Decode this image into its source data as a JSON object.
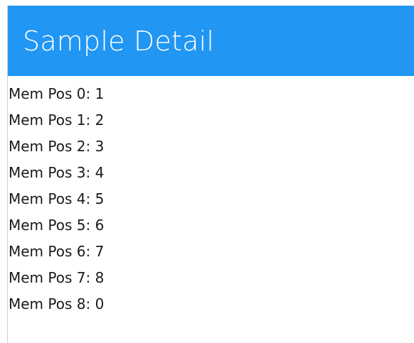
{
  "header": {
    "title": "Sample Detail"
  },
  "items": [
    {
      "label": "Mem Pos 0: 1"
    },
    {
      "label": "Mem Pos 1: 2"
    },
    {
      "label": "Mem Pos 2: 3"
    },
    {
      "label": "Mem Pos 3: 4"
    },
    {
      "label": "Mem Pos 4: 5"
    },
    {
      "label": "Mem Pos 5: 6"
    },
    {
      "label": "Mem Pos 6: 7"
    },
    {
      "label": "Mem Pos 7: 8"
    },
    {
      "label": "Mem Pos 8: 0"
    }
  ],
  "colors": {
    "header_background": "#2196f3",
    "header_text": "#ffffff",
    "body_text": "#1a1a1a"
  }
}
